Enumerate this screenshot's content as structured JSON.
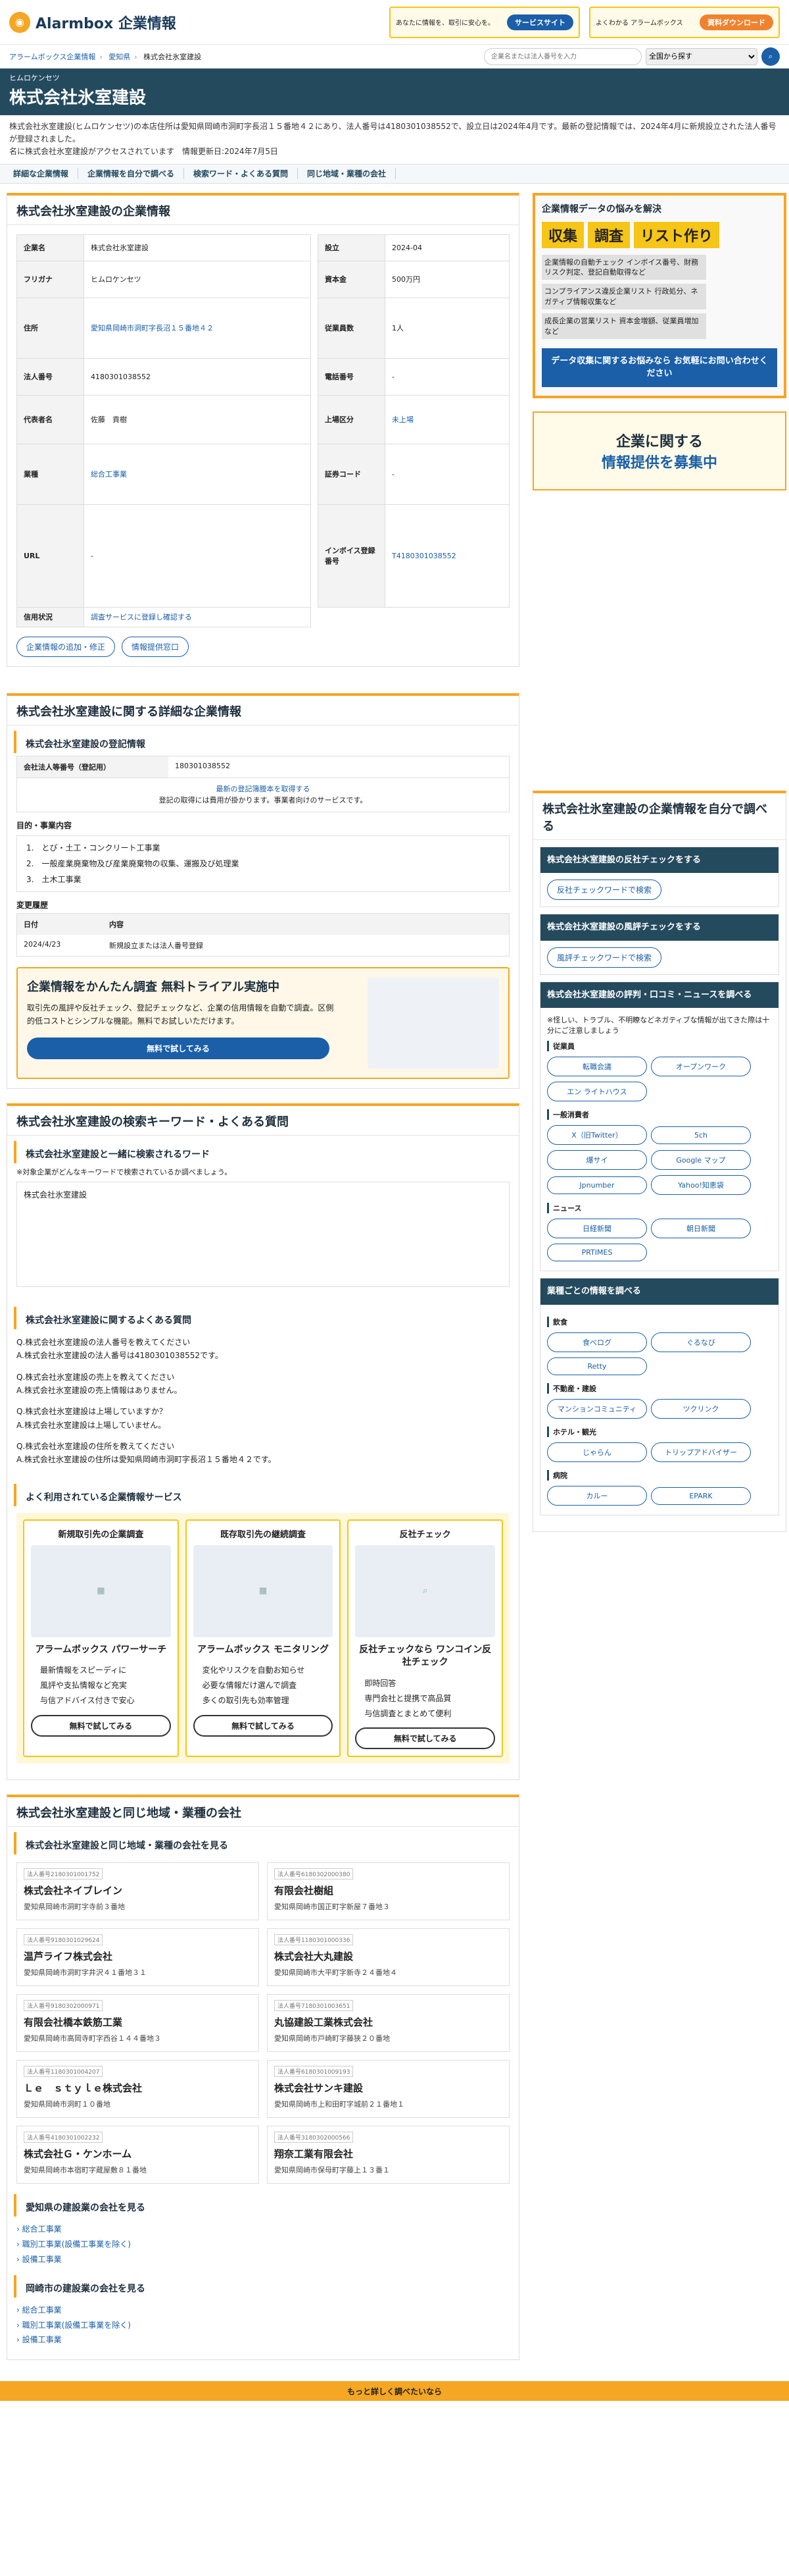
{
  "header": {
    "logo": "Alarmbox 企業情報",
    "banner1": {
      "text": "あなたに情報を、取引に安心を。",
      "cta": "サービスサイト"
    },
    "banner2": {
      "text": "よくわかる アラームボックス",
      "cta": "資料ダウンロード"
    }
  },
  "crumbs": [
    "アラームボックス企業情報",
    "愛知県",
    "株式会社氷室建設"
  ],
  "search": {
    "placeholder": "企業名または法人番号を入力",
    "select": "全国から探す"
  },
  "title": {
    "kana": "ヒムロケンセツ",
    "name": "株式会社氷室建設"
  },
  "intro": [
    "株式会社氷室建設(ヒムロケンセツ)の本店住所は愛知県岡崎市洞町字長沼１５番地４２にあり、法人番号は4180301038552で、設立日は2024年4月です。最新の登記情報では、2024年4月に新規設立された法人番号が登録されました。",
    "名に株式会社氷室建設がアクセスされています　情報更新日:2024年7月5日"
  ],
  "anchors": [
    "詳細な企業情報",
    "企業情報を自分で調べる",
    "検索ワード・よくある質問",
    "同じ地域・業種の会社"
  ],
  "info": {
    "heading": "株式会社氷室建設の企業情報",
    "left": [
      [
        "企業名",
        "株式会社氷室建設"
      ],
      [
        "フリガナ",
        "ヒムロケンセツ"
      ],
      [
        "住所",
        "愛知県岡崎市洞町字長沼１５番地４２"
      ],
      [
        "法人番号",
        "4180301038552"
      ],
      [
        "代表者名",
        "佐藤　貢樹"
      ],
      [
        "業種",
        "総合工事業"
      ],
      [
        "URL",
        "-"
      ],
      [
        "信用状況",
        "調査サービスに登録し確認する"
      ]
    ],
    "right": [
      [
        "設立",
        "2024-04"
      ],
      [
        "資本金",
        "500万円"
      ],
      [
        "従業員数",
        "1人"
      ],
      [
        "電話番号",
        "-"
      ],
      [
        "上場区分",
        "未上場"
      ],
      [
        "証券コード",
        "-"
      ],
      [
        "インボイス登録番号",
        "T4180301038552"
      ]
    ],
    "buttons": [
      "企業情報の追加・修正",
      "情報提供窓口"
    ]
  },
  "detail": {
    "heading": "株式会社氷室建設に関する詳細な企業情報",
    "reg_h": "株式会社氷室建設の登記情報",
    "reg_k": "会社法人等番号（登記用）",
    "reg_v": "180301038552",
    "reg_link": "最新の登記簿謄本を取得する",
    "reg_note": "登記の取得には費用が掛かります。事業者向けのサービスです。",
    "purpose_h": "目的・事業内容",
    "purpose": [
      "1.　とび・土工・コンクリート工事業",
      "2.　一般産業廃棄物及び産業廃棄物の収集、運搬及び処理業",
      "3.　土木工事業"
    ],
    "change_h": "変更履歴",
    "change_cols": [
      "日付",
      "内容"
    ],
    "change_rows": [
      [
        "2024/4/23",
        "新規設立または法人番号登録"
      ]
    ],
    "promo_t": "企業情報をかんたん調査 無料トライアル実施中",
    "promo_p": "取引先の風評や反社チェック、登記チェックなど、企業の信用情報を自動で調査。区側的低コストとシンプルな機能。無料でお試しいただけます。",
    "promo_btn": "無料で試してみる"
  },
  "kw": {
    "heading": "株式会社氷室建設の検索キーワード・よくある質問",
    "kw_h": "株式会社氷室建設と一緒に検索されるワード",
    "kw_note": "※対象企業がどんなキーワードで検索されているか調べましょう。",
    "kw_item": "株式会社氷室建設",
    "faq_h": "株式会社氷室建設に関するよくある質問",
    "faq": [
      [
        "Q.株式会社氷室建設の法人番号を教えてください",
        "A.株式会社氷室建設の法人番号は4180301038552です。"
      ],
      [
        "Q.株式会社氷室建設の売上を教えてください",
        "A.株式会社氷室建設の売上情報はありません。"
      ],
      [
        "Q.株式会社氷室建設は上場していますか？",
        "A.株式会社氷室建設は上場していません。"
      ],
      [
        "Q.株式会社氷室建設の住所を教えてください",
        "A.株式会社氷室建設の住所は愛知県岡崎市洞町字長沼１５番地４２です。"
      ]
    ],
    "svc_h": "よく利用されている企業情報サービス",
    "svcs": [
      {
        "t": "新規取引先の企業調査",
        "n": "アラームボックス パワーサーチ",
        "f": [
          "最新情報をスピーディに",
          "風評や支払情報など充実",
          "与信アドバイス付きで安心"
        ]
      },
      {
        "t": "既存取引先の継続調査",
        "n": "アラームボックス モニタリング",
        "f": [
          "変化やリスクを自動お知らせ",
          "必要な情報だけ選んで調査",
          "多くの取引先も効率管理"
        ]
      },
      {
        "t": "反社チェック",
        "n": "反社チェックなら ワンコイン反社チェック",
        "f": [
          "即時回答",
          "専門会社と提携で高品質",
          "与信調査とまとめて便利"
        ]
      }
    ],
    "svc_btn": "無料で試してみる"
  },
  "area": {
    "heading": "株式会社氷室建設と同じ地域・業種の会社",
    "sub": "株式会社氷室建設と同じ地域・業種の会社を見る",
    "cos": [
      [
        "法人番号2180301001752",
        "株式会社ネイブレイン",
        "愛知県岡崎市洞町字寺前３番地"
      ],
      [
        "法人番号6180302000380",
        "有限会社樹組",
        "愛知県岡崎市国正町字新屋７番地３"
      ],
      [
        "法人番号9180301029624",
        "温芦ライフ株式会社",
        "愛知県岡崎市洞町字井沢４１番地３１"
      ],
      [
        "法人番号1180301000336",
        "株式会社大丸建設",
        "愛知県岡崎市大平町字新寺２４番地４"
      ],
      [
        "法人番号9180302000971",
        "有限会社橋本鉄筋工業",
        "愛知県岡崎市高岡寺町字西谷１４４番地３"
      ],
      [
        "法人番号7180301003651",
        "丸協建設工業株式会社",
        "愛知県岡崎市戸崎町字藤狭２０番地"
      ],
      [
        "法人番号1180301004207",
        "Ｌｅ　ｓｔｙｌｅ株式会社",
        "愛知県岡崎市洞町１０番地"
      ],
      [
        "法人番号6180301009193",
        "株式会社サンキ建設",
        "愛知県岡崎市上和田町字城前２１番地１"
      ],
      [
        "法人番号4180301002232",
        "株式会社Ｇ・ケンホーム",
        "愛知県岡崎市本宿町字蔵屋敷８１番地"
      ],
      [
        "法人番号3180302000566",
        "翔奈工業有限会社",
        "愛知県岡崎市保母町字藤上１３番１"
      ]
    ],
    "pref_h": "愛知県の建設業の会社を見る",
    "pref": [
      "総合工事業",
      "職別工事業(設備工事業を除く)",
      "設備工事業"
    ],
    "city_h": "岡崎市の建設業の会社を見る",
    "city": [
      "総合工事業",
      "職別工事業(設備工事業を除く)",
      "設備工事業"
    ]
  },
  "side": {
    "ad_h": "企業情報データの悩みを解決",
    "ad_tags": [
      "収集",
      "調査",
      "リスト作り"
    ],
    "ad_items": [
      "企業情報の自動チェック インボイス番号、財務リスク判定、登記自動取得など",
      "コンプライアンス違反企業リスト 行政処分、ネガティブ情報収集など",
      "成長企業の営業リスト 資本金増額、従業員増加など"
    ],
    "ad_cta": "データ収集に関するお悩みなら お気軽にお問い合わせください",
    "recruit": [
      "企業に関する",
      "情報提供を募集中"
    ],
    "self_h": "株式会社氷室建設の企業情報を自分で調べる",
    "boxes": [
      {
        "h": "株式会社氷室建設の反社チェックをする",
        "btns": [
          "反社チェックワードで検索"
        ]
      },
      {
        "h": "株式会社氷室建設の風評チェックをする",
        "btns": [
          "風評チェックワードで検索"
        ]
      }
    ],
    "rev_h": "株式会社氷室建設の評判・口コミ・ニュースを調べる",
    "rev_note": "※怪しい、トラブル、不明瞭などネガティブな情報が出てきた際は十分にご注意しましょう",
    "rev_groups": [
      {
        "g": "従業員",
        "b": [
          "転職会議",
          "オープンワーク",
          "エン ライトハウス"
        ]
      },
      {
        "g": "一般消費者",
        "b": [
          "X（旧Twitter）",
          "5ch",
          "爆サイ",
          "Google マップ",
          "Jpnumber",
          "Yahoo!知恵袋"
        ]
      },
      {
        "g": "ニュース",
        "b": [
          "日経新聞",
          "朝日新聞",
          "PRTIMES"
        ]
      }
    ],
    "ind_h": "業種ごとの情報を調べる",
    "ind_groups": [
      {
        "g": "飲食",
        "b": [
          "食べログ",
          "ぐるなび",
          "Retty"
        ]
      },
      {
        "g": "不動産・建設",
        "b": [
          "マンションコミュニティ",
          "ツクリンク"
        ]
      },
      {
        "g": "ホテル・観光",
        "b": [
          "じゃらん",
          "トリップアドバイザー"
        ]
      },
      {
        "g": "病院",
        "b": [
          "カルー",
          "EPARK"
        ]
      }
    ]
  },
  "footer_cta": "もっと詳しく調べたいなら"
}
